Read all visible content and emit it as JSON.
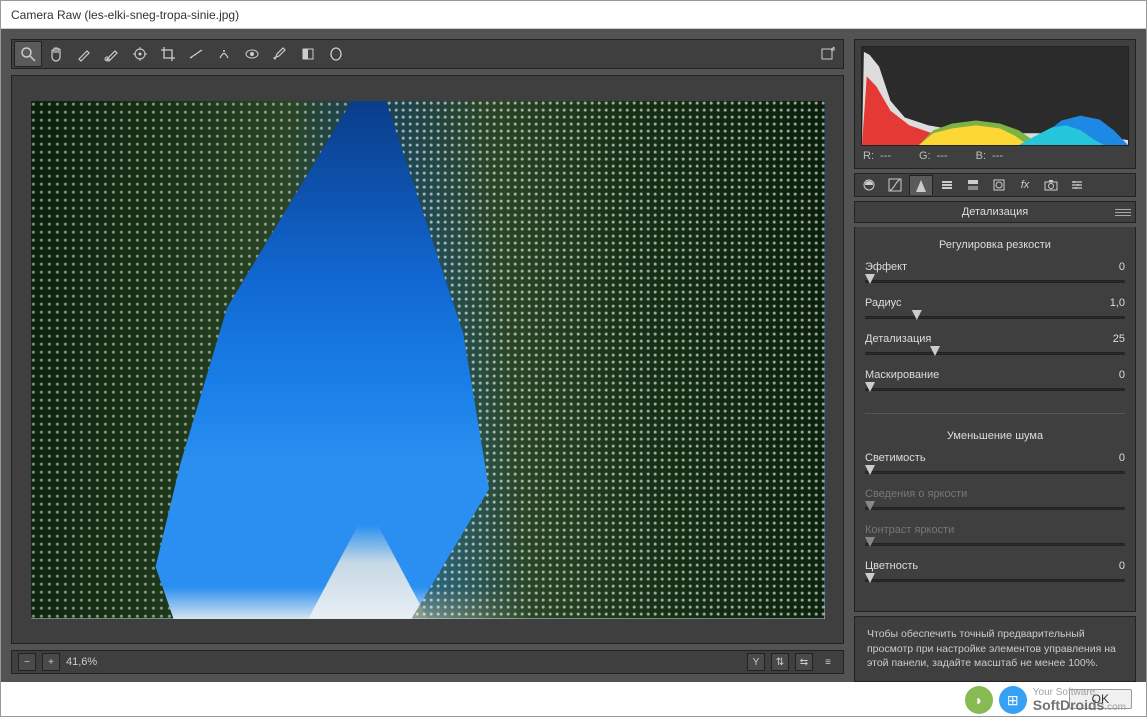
{
  "title": "Camera Raw (les-elki-sneg-tropa-sinie.jpg)",
  "zoom": "41,6%",
  "rgb": {
    "r_label": "R:",
    "r_val": "---",
    "g_label": "G:",
    "g_val": "---",
    "b_label": "B:",
    "b_val": "---"
  },
  "panel_title": "Детализация",
  "sharpen_title": "Регулировка резкости",
  "noise_title": "Уменьшение шума",
  "sliders": {
    "amount": {
      "label": "Эффект",
      "value": "0",
      "pos": 0
    },
    "radius": {
      "label": "Радиус",
      "value": "1,0",
      "pos": 18
    },
    "detail": {
      "label": "Детализация",
      "value": "25",
      "pos": 25
    },
    "masking": {
      "label": "Маскирование",
      "value": "0",
      "pos": 0
    },
    "luminance": {
      "label": "Светимость",
      "value": "0",
      "pos": 0
    },
    "lumdetail": {
      "label": "Сведения о яркости",
      "value": "",
      "pos": 0
    },
    "lumcontrast": {
      "label": "Контраст яркости",
      "value": "",
      "pos": 0
    },
    "color": {
      "label": "Цветность",
      "value": "0",
      "pos": 0
    }
  },
  "hint": "Чтобы обеспечить точный предварительный просмотр при настройке элементов управления на этой панели, задайте масштаб не менее 100%.",
  "ok": "OK",
  "soft": {
    "tag": "Your Software",
    "name": "SoftDroids",
    "suf": ".com"
  }
}
